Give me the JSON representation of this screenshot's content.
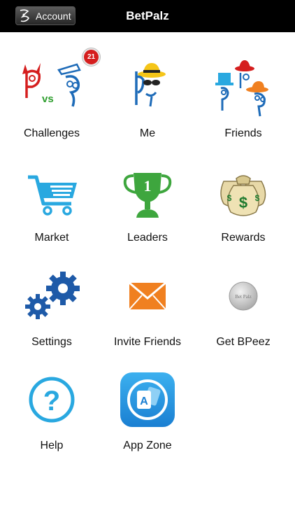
{
  "header": {
    "title": "BetPalz",
    "account_label": "Account"
  },
  "tiles": [
    {
      "label": "Challenges",
      "icon": "challenges-icon",
      "badge": "21"
    },
    {
      "label": "Me",
      "icon": "me-icon"
    },
    {
      "label": "Friends",
      "icon": "friends-icon"
    },
    {
      "label": "Market",
      "icon": "cart-icon"
    },
    {
      "label": "Leaders",
      "icon": "trophy-icon",
      "icon_text": "1"
    },
    {
      "label": "Rewards",
      "icon": "money-bags-icon"
    },
    {
      "label": "Settings",
      "icon": "gears-icon"
    },
    {
      "label": "Invite Friends",
      "icon": "envelope-icon"
    },
    {
      "label": "Get BPeez",
      "icon": "bpeez-coin-icon",
      "icon_text": "Bet Palz"
    },
    {
      "label": "Help",
      "icon": "help-icon",
      "icon_text": "?"
    },
    {
      "label": "App Zone",
      "icon": "app-zone-icon",
      "icon_text": "A"
    }
  ],
  "colors": {
    "header_bg": "#000000",
    "blue": "#1e6bb8",
    "cyan": "#29a8e0",
    "green": "#2e9e2e",
    "orange": "#f08020",
    "red": "#d51e1e"
  }
}
